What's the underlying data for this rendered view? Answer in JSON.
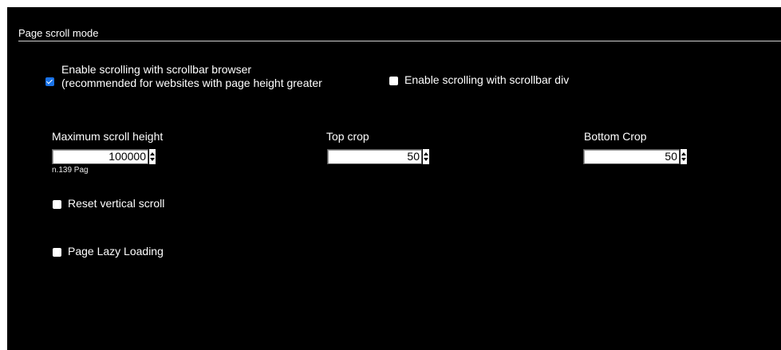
{
  "section": {
    "title": "Page scroll mode"
  },
  "scroll_options": {
    "browser": {
      "line1": "Enable scrolling with scrollbar browser",
      "line2": "(recommended for websites with page height greater",
      "checked": true
    },
    "div": {
      "label": "Enable scrolling with scrollbar div",
      "checked": false
    }
  },
  "fields": {
    "max_scroll_height": {
      "label": "Maximum scroll height",
      "value": "100000",
      "hint": "n.139 Pag"
    },
    "top_crop": {
      "label": "Top crop",
      "value": "50"
    },
    "bottom_crop": {
      "label": "Bottom Crop",
      "value": "50"
    }
  },
  "options": {
    "reset_vertical_scroll": {
      "label": "Reset vertical scroll",
      "checked": false
    },
    "page_lazy_loading": {
      "label": "Page Lazy Loading",
      "checked": false
    }
  }
}
